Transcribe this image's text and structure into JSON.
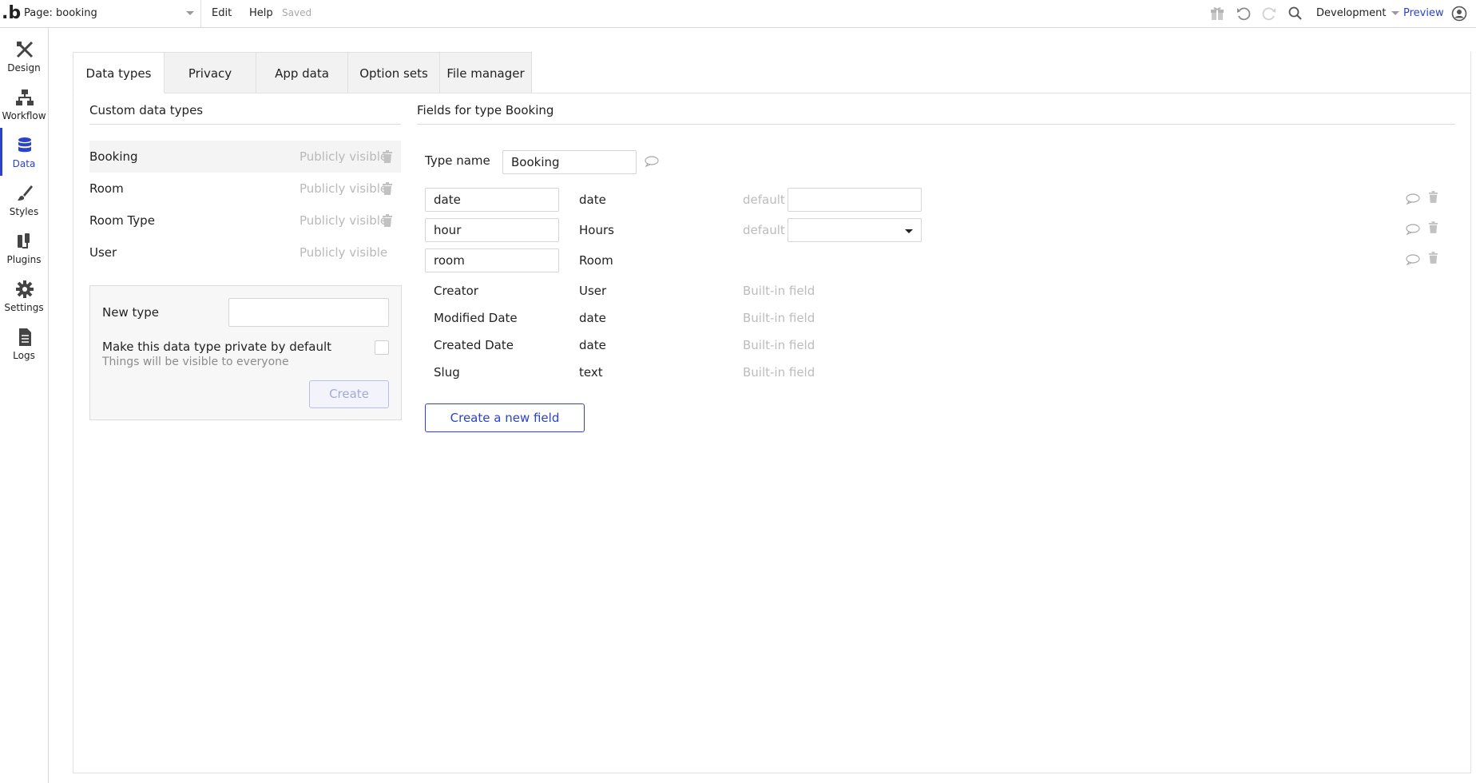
{
  "topbar": {
    "logo": ".b",
    "page_selector": "Page: booking",
    "menu_edit": "Edit",
    "menu_help": "Help",
    "save_status": "Saved",
    "environment": "Development",
    "preview": "Preview",
    "icons": [
      "gift-icon",
      "undo-icon",
      "redo-icon",
      "search-icon",
      "account-icon"
    ]
  },
  "rail": {
    "items": [
      {
        "label": "Design",
        "icon": "design-icon"
      },
      {
        "label": "Workflow",
        "icon": "workflow-icon"
      },
      {
        "label": "Data",
        "icon": "database-icon"
      },
      {
        "label": "Styles",
        "icon": "brush-icon"
      },
      {
        "label": "Plugins",
        "icon": "plug-icon"
      },
      {
        "label": "Settings",
        "icon": "gear-icon"
      },
      {
        "label": "Logs",
        "icon": "document-icon"
      }
    ],
    "active": "Data"
  },
  "tabs": [
    "Data types",
    "Privacy",
    "App data",
    "Option sets",
    "File manager"
  ],
  "active_tab": "Data types",
  "custom_types": {
    "title": "Custom data types",
    "items": [
      {
        "name": "Booking",
        "visibility": "Publicly visible",
        "deletable": true
      },
      {
        "name": "Room",
        "visibility": "Publicly visible",
        "deletable": true
      },
      {
        "name": "Room Type",
        "visibility": "Publicly visible",
        "deletable": true
      },
      {
        "name": "User",
        "visibility": "Publicly visible",
        "deletable": false
      }
    ],
    "new_type_label": "New type",
    "new_type_value": "",
    "private_label": "Make this data type private by default",
    "private_hint": "Things will be visible to everyone",
    "create_label": "Create"
  },
  "fields": {
    "title": "Fields for type Booking",
    "type_name_label": "Type name",
    "type_name_value": "Booking",
    "custom_fields": [
      {
        "name": "date",
        "type": "date",
        "default_label": "default",
        "default_value": "",
        "default_kind": "text"
      },
      {
        "name": "hour",
        "type": "Hours",
        "default_label": "default",
        "default_value": "",
        "default_kind": "dropdown"
      },
      {
        "name": "room",
        "type": "Room"
      }
    ],
    "builtin_fields": [
      {
        "name": "Creator",
        "type": "User",
        "tag": "Built-in field"
      },
      {
        "name": "Modified Date",
        "type": "date",
        "tag": "Built-in field"
      },
      {
        "name": "Created Date",
        "type": "date",
        "tag": "Built-in field"
      },
      {
        "name": "Slug",
        "type": "text",
        "tag": "Built-in field"
      }
    ],
    "create_field_label": "Create a new field"
  },
  "colors": {
    "accent": "#2a43c9",
    "muted": "#b9b9b9"
  }
}
